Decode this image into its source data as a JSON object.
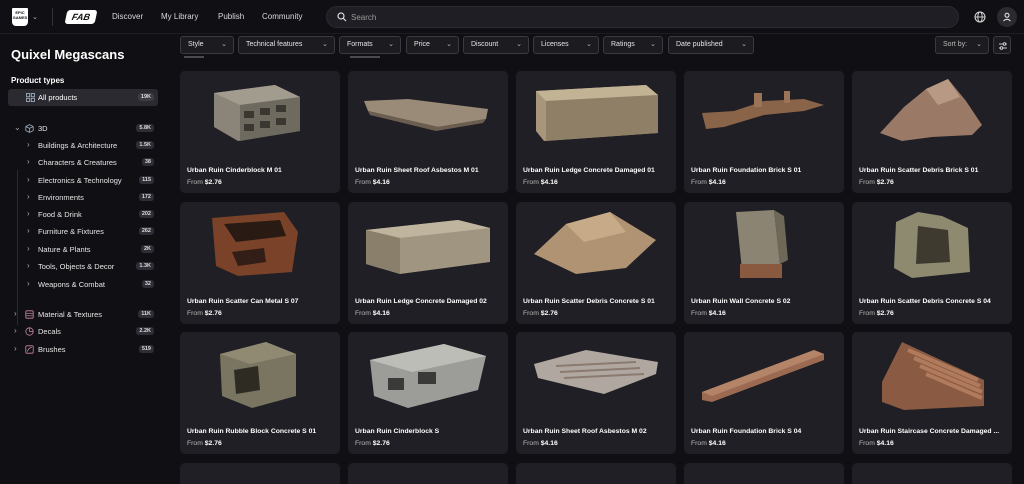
{
  "nav": {
    "epic_logo_text": "EPIC GAMES",
    "fab_logo_text": "FAB",
    "links": [
      "Discover",
      "My Library",
      "Publish",
      "Community"
    ],
    "search_placeholder": "Search"
  },
  "sidebar": {
    "title": "Quixel Megascans",
    "section_label": "Product types",
    "all_products": {
      "label": "All products",
      "count": "19K"
    },
    "categories": [
      {
        "label": "3D",
        "count": "5.8K",
        "expanded": true
      },
      {
        "label": "Buildings & Architecture",
        "count": "1.5K"
      },
      {
        "label": "Characters & Creatures",
        "count": "38"
      },
      {
        "label": "Electronics & Technology",
        "count": "115"
      },
      {
        "label": "Environments",
        "count": "172"
      },
      {
        "label": "Food & Drink",
        "count": "202"
      },
      {
        "label": "Furniture & Fixtures",
        "count": "262"
      },
      {
        "label": "Nature & Plants",
        "count": "2K"
      },
      {
        "label": "Tools, Objects & Decor",
        "count": "1.3K"
      },
      {
        "label": "Weapons & Combat",
        "count": "32"
      },
      {
        "label": "Material & Textures",
        "count": "11K"
      },
      {
        "label": "Decals",
        "count": "2.2K"
      },
      {
        "label": "Brushes",
        "count": "519"
      }
    ]
  },
  "filters": [
    "Style",
    "Technical features",
    "Formats",
    "Price",
    "Discount",
    "Licenses",
    "Ratings",
    "Date published"
  ],
  "sort_label": "Sort by:",
  "price_prefix": "From",
  "products": [
    {
      "name": "Urban Ruin Cinderblock M 01",
      "price": "$2.76"
    },
    {
      "name": "Urban Ruin Sheet Roof Asbestos M 01",
      "price": "$4.16"
    },
    {
      "name": "Urban Ruin Ledge Concrete Damaged 01",
      "price": "$4.16"
    },
    {
      "name": "Urban Ruin Foundation Brick S 01",
      "price": "$4.16"
    },
    {
      "name": "Urban Ruin Scatter Debris Brick S 01",
      "price": "$2.76"
    },
    {
      "name": "Urban Ruin Scatter Can Metal S 07",
      "price": "$2.76"
    },
    {
      "name": "Urban Ruin Ledge Concrete Damaged 02",
      "price": "$4.16"
    },
    {
      "name": "Urban Ruin Scatter Debris Concrete S 01",
      "price": "$2.76"
    },
    {
      "name": "Urban Ruin Wall Concrete S 02",
      "price": "$4.16"
    },
    {
      "name": "Urban Ruin Scatter Debris Concrete S 04",
      "price": "$2.76"
    },
    {
      "name": "Urban Ruin Rubble Block Concrete S 01",
      "price": "$2.76"
    },
    {
      "name": "Urban Ruin Cinderblock S",
      "price": "$2.76"
    },
    {
      "name": "Urban Ruin Sheet Roof Asbestos M 02",
      "price": "$4.16"
    },
    {
      "name": "Urban Ruin Foundation Brick S 04",
      "price": "$4.16"
    },
    {
      "name": "Urban Ruin Staircase Concrete Damaged ...",
      "price": "$4.16"
    }
  ]
}
